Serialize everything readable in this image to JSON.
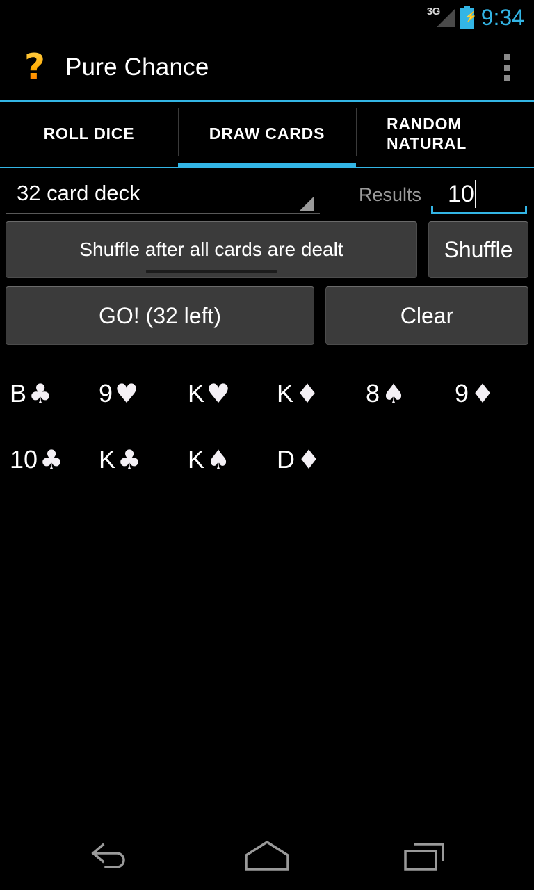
{
  "status_bar": {
    "network_label": "3G",
    "battery_icon": "battery-charging-icon",
    "signal_icon": "signal-triangle-icon",
    "time": "9:34",
    "accent_color": "#33b5e5"
  },
  "action_bar": {
    "logo_glyph": "?",
    "logo_icon": "question-mark-logo",
    "title": "Pure Chance",
    "overflow_icon": "overflow-menu-icon"
  },
  "tabs": [
    {
      "label": "ROLL DICE",
      "active": false
    },
    {
      "label": "DRAW CARDS",
      "active": true
    },
    {
      "label": "RANDOM NATURAL",
      "active": false
    }
  ],
  "controls": {
    "deck_spinner": {
      "value": "32 card deck",
      "arrow_icon": "spinner-arrow-icon"
    },
    "results": {
      "label": "Results",
      "value": "10"
    },
    "shuffle_toggle_label": "Shuffle after all cards are dealt",
    "shuffle_button_label": "Shuffle",
    "go_button_label": "GO! (32 left)",
    "clear_button_label": "Clear"
  },
  "results_cards": [
    {
      "rank": "B",
      "suit": "♣"
    },
    {
      "rank": "9",
      "suit": "♥"
    },
    {
      "rank": "K",
      "suit": "♥"
    },
    {
      "rank": "K",
      "suit": "♦"
    },
    {
      "rank": "8",
      "suit": "♠"
    },
    {
      "rank": "9",
      "suit": "♦"
    },
    {
      "rank": "10",
      "suit": "♣"
    },
    {
      "rank": "K",
      "suit": "♣"
    },
    {
      "rank": "K",
      "suit": "♠"
    },
    {
      "rank": "D",
      "suit": "♦"
    }
  ],
  "nav_bar": {
    "back_icon": "back-arrow-icon",
    "home_icon": "home-icon",
    "recents_icon": "recent-apps-icon"
  }
}
